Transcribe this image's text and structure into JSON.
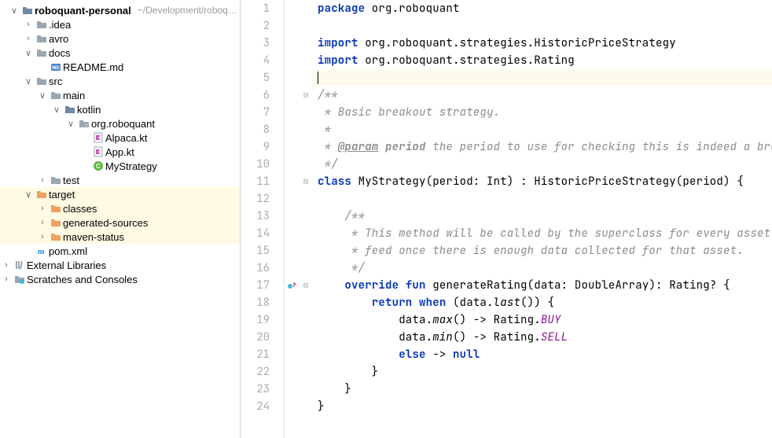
{
  "tree": {
    "root": {
      "label": "roboquant-personal",
      "suffix": "~/Development/roboq…"
    },
    "idea": ".idea",
    "avro": "avro",
    "docs": "docs",
    "readme": "README.md",
    "src": "src",
    "main": "main",
    "kotlin": "kotlin",
    "orgroboquant": "org.roboquant",
    "alpaca": "Alpaca.kt",
    "app": "App.kt",
    "mystrategy": "MyStrategy",
    "test": "test",
    "target": "target",
    "classes": "classes",
    "gensources": "generated-sources",
    "mavenstatus": "maven-status",
    "pom": "pom.xml",
    "extlib": "External Libraries",
    "scratches": "Scratches and Consoles"
  },
  "code": {
    "l1_kw": "package",
    "l1_pkg": " org.roboquant",
    "l3_kw": "import",
    "l3_pkg": " org.roboquant.strategies.HistoricPriceStrategy",
    "l4_kw": "import",
    "l4_pkg": " org.roboquant.strategies.Rating",
    "l6": "/**",
    "l7": " * Basic breakout strategy.",
    "l8": " *",
    "l9a": " * ",
    "l9b": "@param",
    "l9c": " period",
    "l9d": " the period to use for checking this is indeed a breakout",
    "l10": " */",
    "l11_kw": "class",
    "l11_rest": " MyStrategy(period: Int) : HistoricPriceStrategy(period) {",
    "l13": "    /**",
    "l14": "     * This method will be called by the superclass for every asset in the",
    "l15": "     * feed once there is enough data collected for that asset.",
    "l16": "     */",
    "l17_kw1": "override",
    "l17_s1": " ",
    "l17_kw2": "fun",
    "l17_s2": " ",
    "l17_fn": "generateRating",
    "l17_rest": "(data: DoubleArray): Rating? {",
    "l18_in": "        ",
    "l18_kw1": "return",
    "l18_s1": " ",
    "l18_kw2": "when",
    "l18_rest1": " (data.",
    "l18_fn": "last",
    "l18_rest2": "()) {",
    "l19_in": "            data.",
    "l19_fn": "max",
    "l19_rest": "() -> Rating.",
    "l19_en": "BUY",
    "l20_in": "            data.",
    "l20_fn": "min",
    "l20_rest": "() -> Rating.",
    "l20_en": "SELL",
    "l21_in": "            ",
    "l21_kw": "else",
    "l21_s": " -> ",
    "l21_kw2": "null",
    "l22": "        }",
    "l23": "    }",
    "l24": "}"
  },
  "lineNumbers": [
    "1",
    "2",
    "3",
    "4",
    "5",
    "6",
    "7",
    "8",
    "9",
    "10",
    "11",
    "12",
    "13",
    "14",
    "15",
    "16",
    "17",
    "18",
    "19",
    "20",
    "21",
    "22",
    "23",
    "24"
  ]
}
